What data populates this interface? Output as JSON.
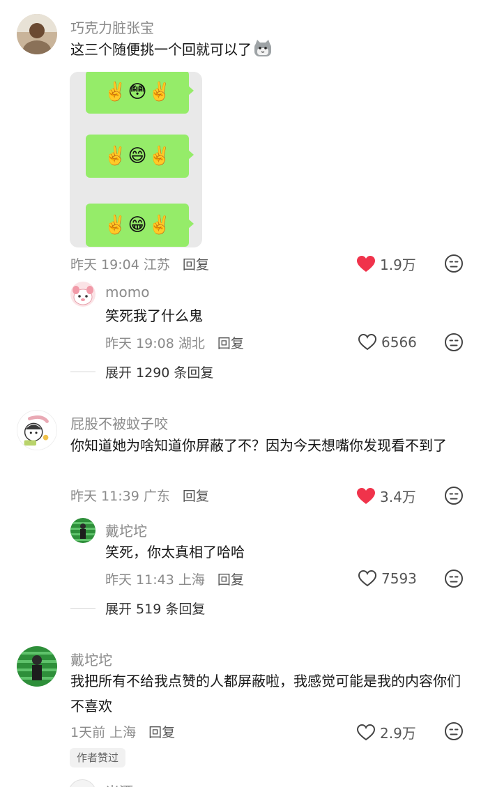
{
  "comments": [
    {
      "author": "巧克力脏张宝",
      "text": "这三个随便挑一个回就可以了",
      "emoji_suffix": "cat-emoji",
      "image": {
        "rows": [
          {
            "left": "✌️",
            "mid": "😳",
            "right": "✌️"
          },
          {
            "left": "✌️",
            "mid": "😄",
            "right": "✌️"
          },
          {
            "left": "✌️",
            "mid": "😁",
            "right": "✌️"
          }
        ]
      },
      "time": "昨天 19:04 江苏",
      "reply_label": "回复",
      "likes": "1.9万",
      "liked": true,
      "replies": [
        {
          "author": "momo",
          "text": "笑死我了什么鬼",
          "time": "昨天 19:08 湖北",
          "reply_label": "回复",
          "likes": "6566",
          "liked": false
        }
      ],
      "expand_label": "展开 1290 条回复"
    },
    {
      "author": "屁股不被蚊子咬",
      "text": "你知道她为啥知道你屏蔽了不？因为今天想嘴你发现看不到了",
      "time": "昨天 11:39 广东",
      "reply_label": "回复",
      "likes": "3.4万",
      "liked": true,
      "replies": [
        {
          "author": "戴坨坨",
          "text": "笑死，你太真相了哈哈",
          "time": "昨天 11:43 上海",
          "reply_label": "回复",
          "likes": "7593",
          "liked": false
        }
      ],
      "expand_label": "展开 519 条回复"
    },
    {
      "author": "戴坨坨",
      "text": "我把所有不给我点赞的人都屏蔽啦，我感觉可能是我的内容你们不喜欢",
      "time": "1天前 上海",
      "reply_label": "回复",
      "likes": "2.9万",
      "liked": false,
      "badge": "作者赞过"
    }
  ],
  "partial_next_author": "米酒",
  "colors": {
    "liked_heart": "#f0334b",
    "bubble_green": "#95ec69",
    "card_bg": "#e9e9e9",
    "meta_gray": "#8a8a8a"
  },
  "icons": [
    "heart-filled-icon",
    "heart-outline-icon",
    "dislike-face-icon",
    "cat-emoji"
  ]
}
